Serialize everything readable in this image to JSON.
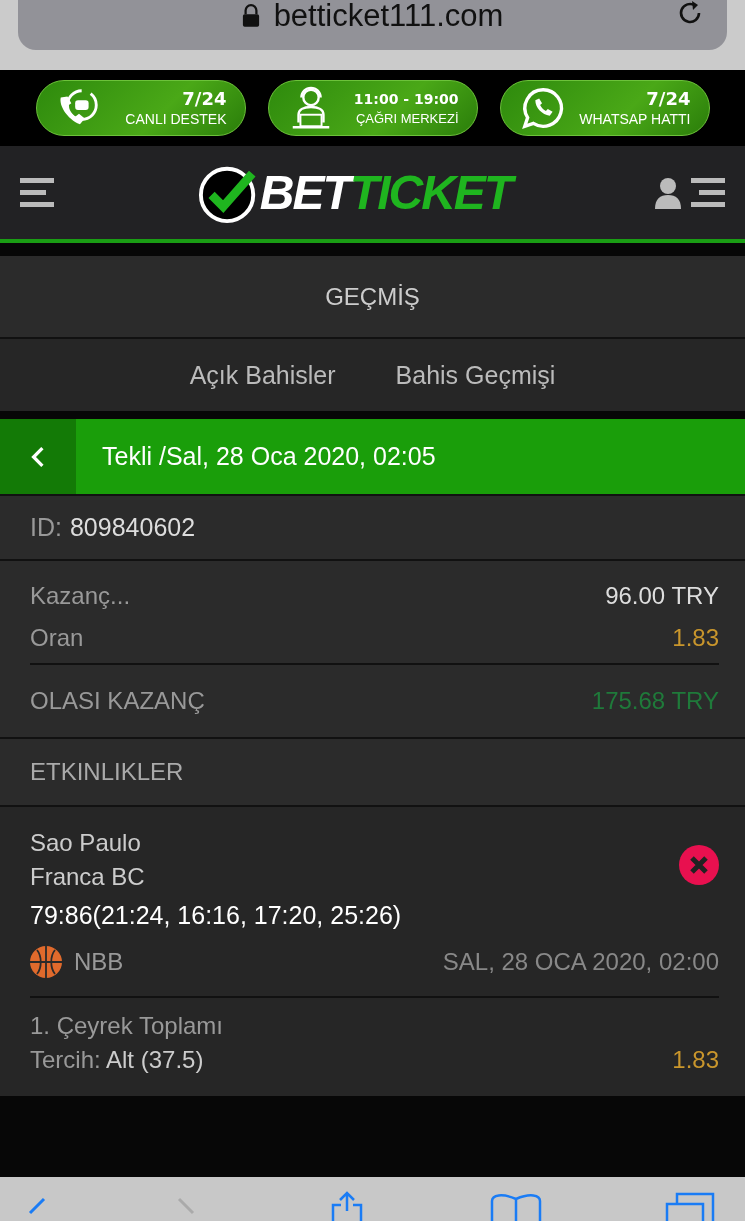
{
  "browser": {
    "url": "betticket111.com"
  },
  "promo_badges": [
    {
      "kind": "phone",
      "headline": "7/24",
      "label": "CANLI DESTEK"
    },
    {
      "kind": "operator",
      "headline": "11:00 - 19:00",
      "label": "ÇAĞRI MERKEZİ"
    },
    {
      "kind": "whatsapp",
      "headline": "7/24",
      "label": "WHATSAP HATTI"
    }
  ],
  "header": {
    "logo_left": "BET",
    "logo_right": "TICKET"
  },
  "page_title": "GEÇMİŞ",
  "tabs": [
    {
      "label": "Açık Bahisler"
    },
    {
      "label": "Bahis Geçmişi"
    }
  ],
  "ticket_bar": {
    "title": "Tekli /Sal, 28 Oca 2020, 02:05"
  },
  "ticket_id": {
    "label": "ID:",
    "value": "809840602"
  },
  "summary": [
    {
      "label": "Kazanç...",
      "value": "96.00 TRY",
      "kind": "plain"
    },
    {
      "label": "Oran",
      "value": "1.83",
      "kind": "odds"
    }
  ],
  "potential": {
    "label": "OLASI KAZANÇ",
    "value": "175.68 TRY"
  },
  "events_title": "ETKINLIKLER",
  "event": {
    "home": "Sao Paulo",
    "away": "Franca BC",
    "score": "79:86(21:24, 16:16, 17:20, 25:26)",
    "league": "NBB",
    "date": "SAL, 28 OCA 2020, 02:00",
    "market": "1. Çeyrek Toplamı",
    "choice_label": "Tercih:",
    "choice": "Alt (37.5)",
    "odds": "1.83"
  }
}
